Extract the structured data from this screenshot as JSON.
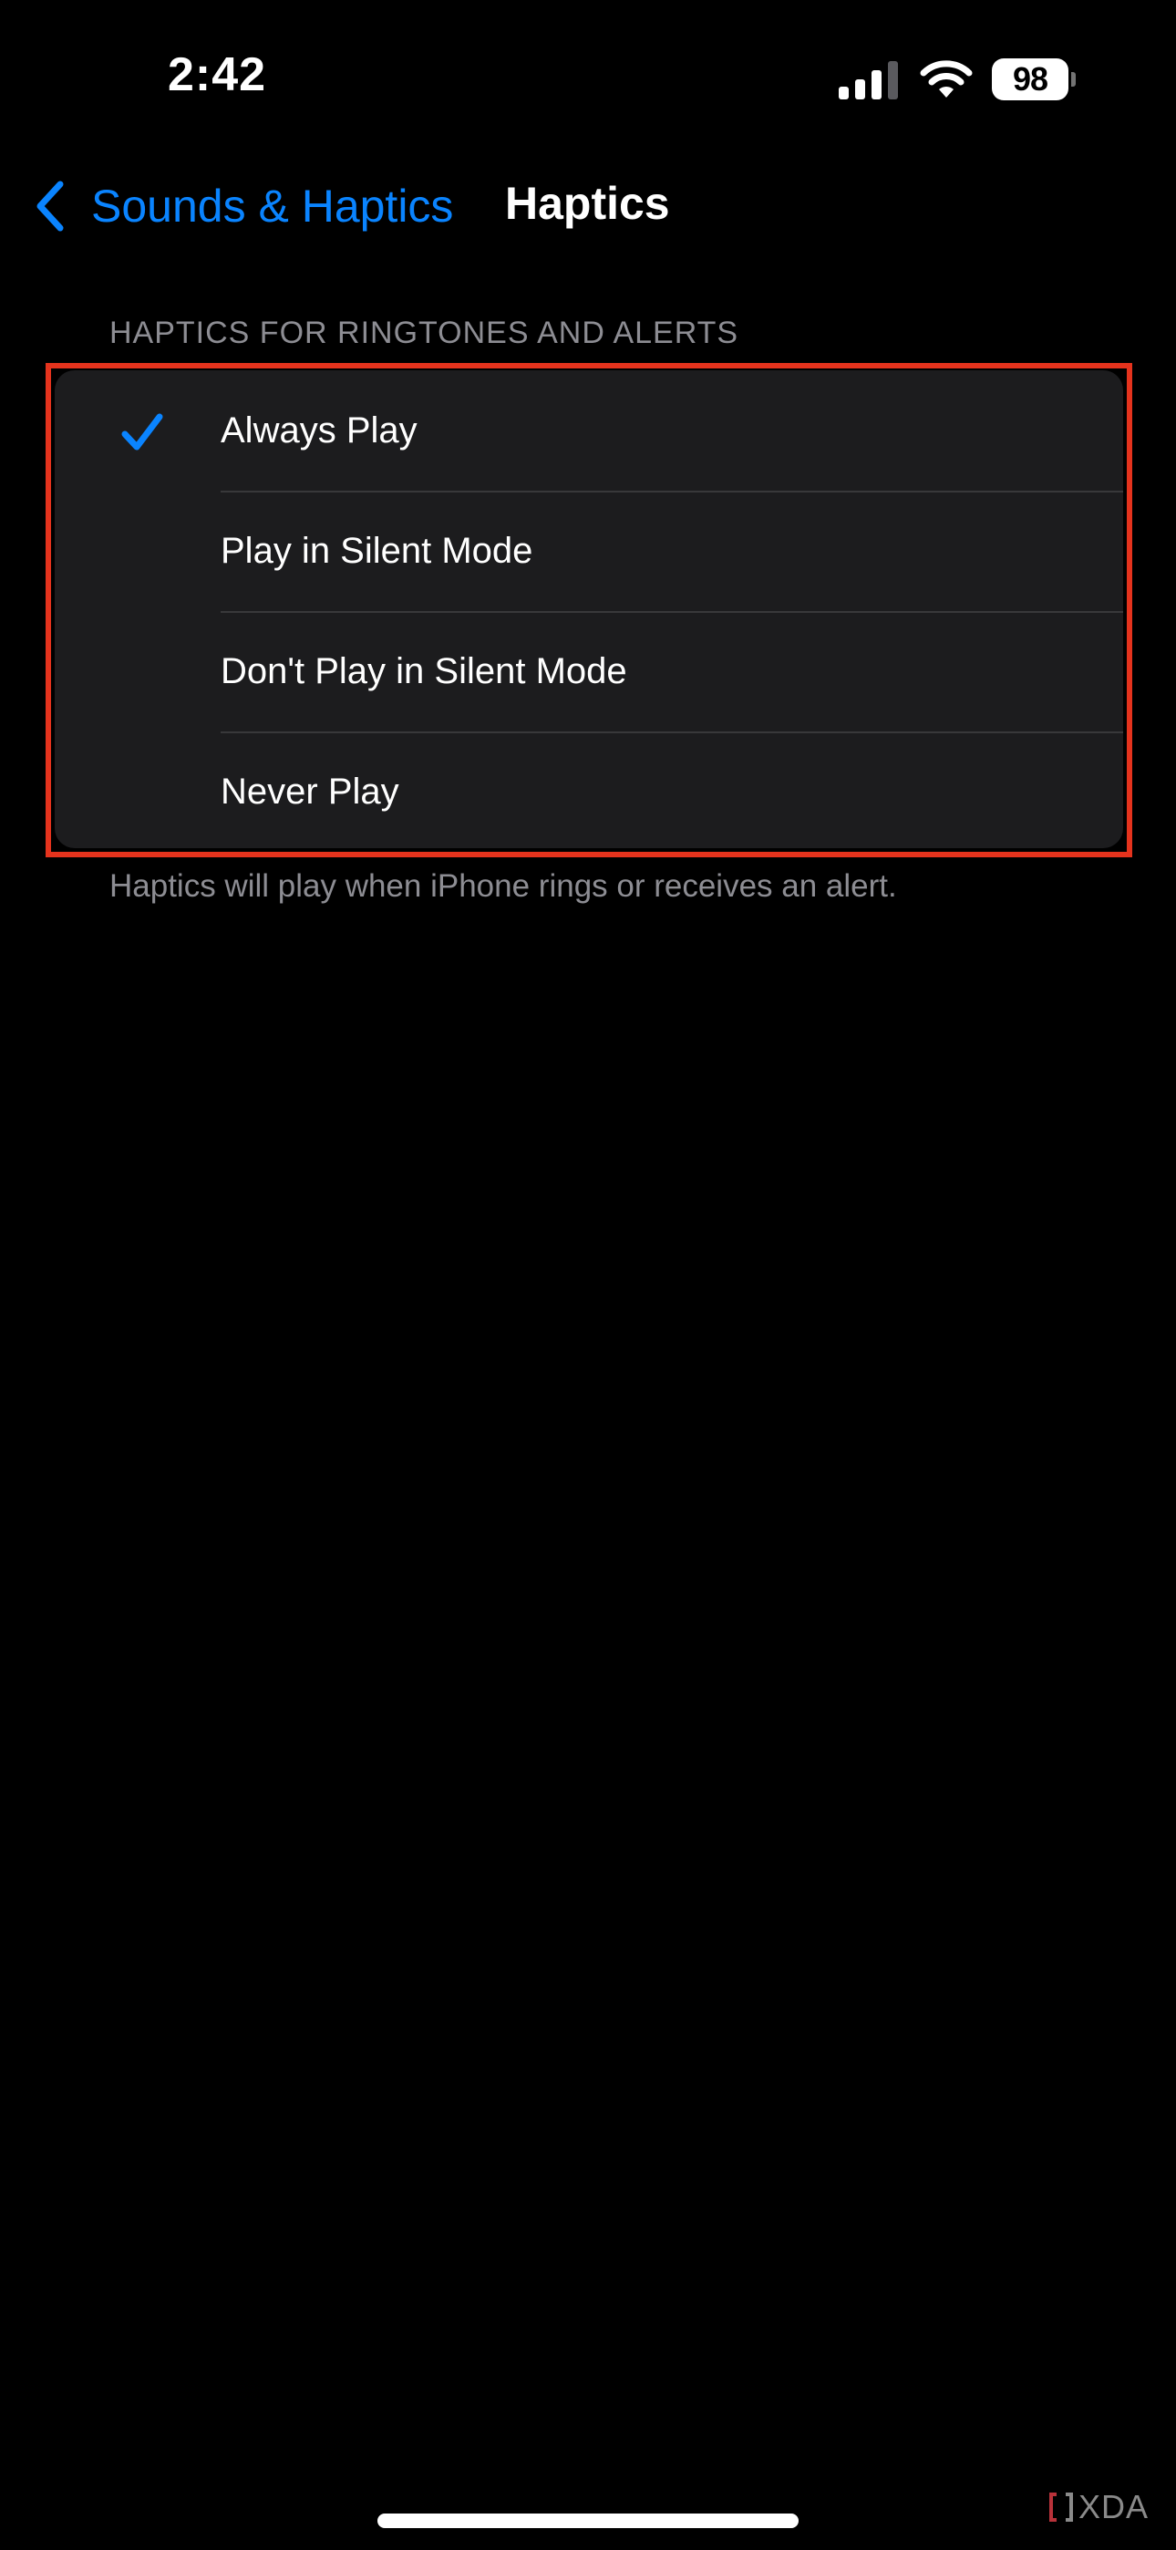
{
  "status_bar": {
    "time": "2:42",
    "battery_level": "98",
    "icons": [
      "signal-icon",
      "wifi-icon",
      "battery-icon"
    ]
  },
  "nav": {
    "back_label": "Sounds & Haptics",
    "back_icon": "chevron-left-icon",
    "title": "Haptics"
  },
  "section": {
    "header": "HAPTICS FOR RINGTONES AND ALERTS",
    "options": [
      {
        "label": "Always Play",
        "selected": true
      },
      {
        "label": "Play in Silent Mode",
        "selected": false
      },
      {
        "label": "Don't Play in Silent Mode",
        "selected": false
      },
      {
        "label": "Never Play",
        "selected": false
      }
    ],
    "footer": "Haptics will play when iPhone rings or receives an alert."
  },
  "watermark": "XDA",
  "colors": {
    "accent": "#0a84ff",
    "background": "#000000",
    "group_background": "#1c1c1e",
    "secondary_text": "#8d8d93",
    "highlight": "#e5331d"
  }
}
